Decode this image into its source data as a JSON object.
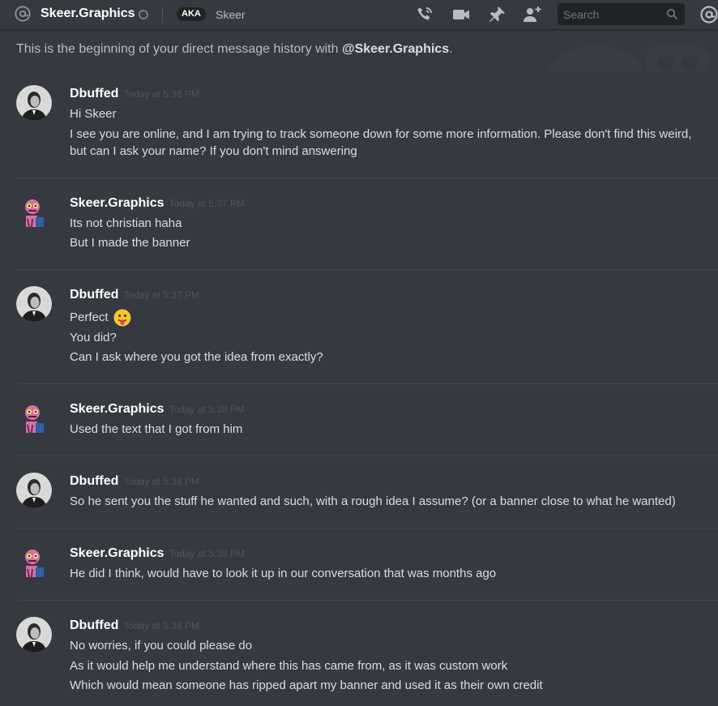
{
  "header": {
    "channel_name": "Skeer.Graphics",
    "aka_label": "AKA",
    "aka_name": "Skeer",
    "search_placeholder": "Search",
    "icons": [
      "at-icon",
      "call-icon",
      "video-icon",
      "pin-icon",
      "add-user-icon",
      "search-icon",
      "mention-icon"
    ]
  },
  "intro": {
    "prefix": "This is the beginning of your direct message history with ",
    "handle": "@Skeer.Graphics",
    "suffix": "."
  },
  "messages": [
    {
      "author": "Dbuffed",
      "timestamp": "Today at 5:36 PM",
      "lines": [
        "Hi Skeer",
        "I see you are online, and I am trying to track someone down for some more information. Please don't find this weird,",
        "but can I ask your name? If you don't mind answering"
      ]
    },
    {
      "author": "Skeer.Graphics",
      "timestamp": "Today at 5:37 PM",
      "lines": [
        "Its not christian haha",
        "But I made the banner"
      ]
    },
    {
      "author": "Dbuffed",
      "timestamp": "Today at 5:37 PM",
      "lines": [
        "Perfect",
        "You did?",
        "Can I ask where you got the idea from exactly?"
      ],
      "emoji": "stuck-out-tongue-emoji"
    },
    {
      "author": "Skeer.Graphics",
      "timestamp": "Today at 5:38 PM",
      "lines": [
        "Used the text that I got from him"
      ]
    },
    {
      "author": "Dbuffed",
      "timestamp": "Today at 5:38 PM",
      "lines": [
        "So he sent you the stuff he wanted and such, with a rough idea I assume? (or a banner close to what he wanted)"
      ]
    },
    {
      "author": "Skeer.Graphics",
      "timestamp": "Today at 5:38 PM",
      "lines": [
        "He did I think, would have to look it up in our conversation that was months ago"
      ]
    },
    {
      "author": "Dbuffed",
      "timestamp": "Today at 5:38 PM",
      "lines": [
        "No worries, if you could please do",
        "As it would help me understand where this has came from, as it was custom work",
        "Which would mean someone has ripped apart my banner and used it as their own credit"
      ]
    }
  ],
  "colors": {
    "background": "#36393f",
    "text": "#dcddde",
    "username": "#ffffff",
    "timestamp": "#4f545c",
    "muted": "#b9bbbe"
  }
}
